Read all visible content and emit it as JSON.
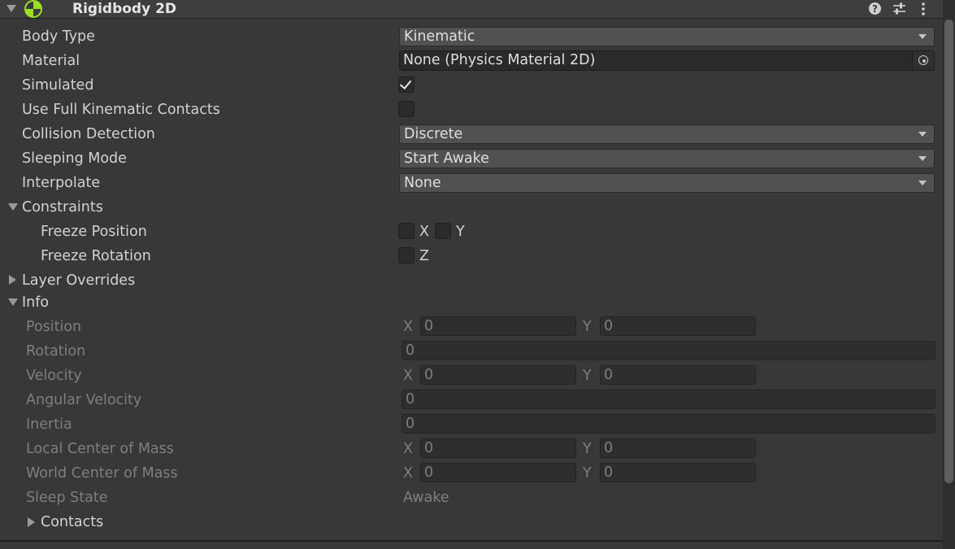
{
  "component": {
    "title": "Rigidbody 2D",
    "icons": [
      "fold-down-icon",
      "rigidbody-2d-icon",
      "help-icon",
      "presets-icon",
      "more-menu-icon"
    ]
  },
  "fields": {
    "body_type": {
      "label": "Body Type",
      "value": "Kinematic"
    },
    "material": {
      "label": "Material",
      "value": "None (Physics Material 2D)"
    },
    "simulated": {
      "label": "Simulated",
      "checked": true
    },
    "use_full_kinematic_contacts": {
      "label": "Use Full Kinematic Contacts",
      "checked": false
    },
    "collision_detection": {
      "label": "Collision Detection",
      "value": "Discrete"
    },
    "sleeping_mode": {
      "label": "Sleeping Mode",
      "value": "Start Awake"
    },
    "interpolate": {
      "label": "Interpolate",
      "value": "None"
    }
  },
  "constraints": {
    "label": "Constraints",
    "freeze_position": {
      "label": "Freeze Position",
      "x_label": "X",
      "y_label": "Y",
      "x": false,
      "y": false
    },
    "freeze_rotation": {
      "label": "Freeze Rotation",
      "z_label": "Z",
      "z": false
    }
  },
  "layer_overrides": {
    "label": "Layer Overrides"
  },
  "info": {
    "label": "Info",
    "position": {
      "label": "Position",
      "x_label": "X",
      "y_label": "Y",
      "x": "0",
      "y": "0"
    },
    "rotation": {
      "label": "Rotation",
      "value": "0"
    },
    "velocity": {
      "label": "Velocity",
      "x_label": "X",
      "y_label": "Y",
      "x": "0",
      "y": "0"
    },
    "angular_velocity": {
      "label": "Angular Velocity",
      "value": "0"
    },
    "inertia": {
      "label": "Inertia",
      "value": "0"
    },
    "local_center_of_mass": {
      "label": "Local Center of Mass",
      "x_label": "X",
      "y_label": "Y",
      "x": "0",
      "y": "0"
    },
    "world_center_of_mass": {
      "label": "World Center of Mass",
      "x_label": "X",
      "y_label": "Y",
      "x": "0",
      "y": "0"
    },
    "sleep_state": {
      "label": "Sleep State",
      "value": "Awake"
    },
    "contacts": {
      "label": "Contacts"
    }
  },
  "colors": {
    "background": "#383838",
    "header": "#3e3e3e",
    "text": "#d2d2d2",
    "disabled_text": "#7e7e7e",
    "icon_green": "#9be022"
  }
}
